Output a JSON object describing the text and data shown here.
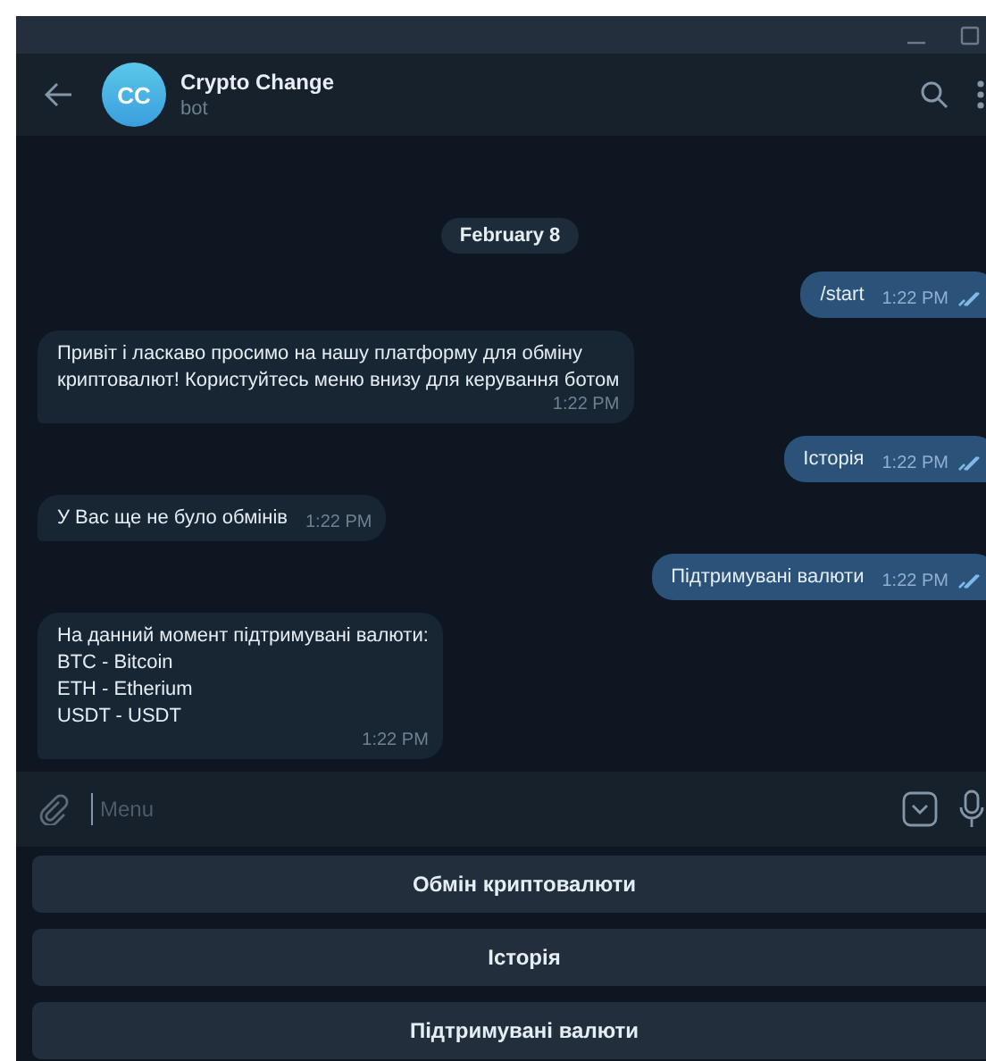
{
  "header": {
    "avatar": "CC",
    "title": "Crypto Change",
    "subtitle": "bot"
  },
  "date": "February 8",
  "messages": [
    {
      "outgoing": true,
      "text": "/start",
      "time": "1:22 PM",
      "read": true
    },
    {
      "outgoing": false,
      "text": "Привіт і ласкаво просимо на нашу платформу для обміну\nкриптовалют! Користуйтесь меню внизу для керування ботом",
      "time": "1:22 PM"
    },
    {
      "outgoing": true,
      "text": "Історія",
      "time": "1:22 PM",
      "read": true
    },
    {
      "outgoing": false,
      "text": "У Вас ще не було обмінів",
      "time": "1:22 PM"
    },
    {
      "outgoing": true,
      "text": "Підтримувані валюти",
      "time": "1:22 PM",
      "read": true
    },
    {
      "outgoing": false,
      "text": "На данний момент підтримувані валюти:\nBTC - Bitcoin\nETH - Etherium\nUSDT - USDT",
      "time": "1:22 PM"
    }
  ],
  "input": {
    "placeholder": "Menu"
  },
  "keyboard": [
    "Обмін криптовалюти",
    "Історія",
    "Підтримувані валюти"
  ]
}
